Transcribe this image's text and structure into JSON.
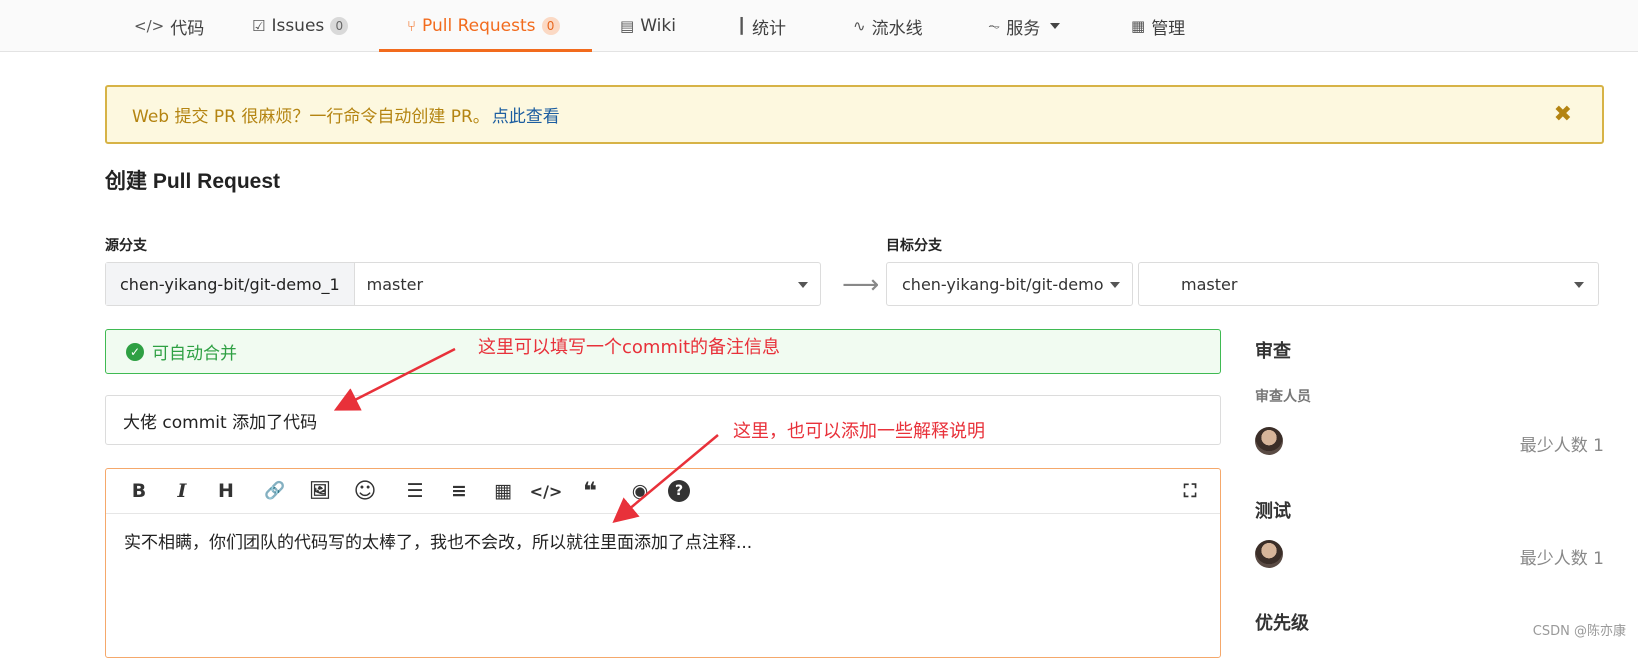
{
  "nav": {
    "tabs": [
      {
        "label": "代码",
        "icon": "code-icon",
        "glyph": "</>"
      },
      {
        "label": "Issues",
        "icon": "issues-icon",
        "glyph": "☑",
        "count": "0"
      },
      {
        "label": "Pull Requests",
        "icon": "pull-request-icon",
        "glyph": "⑂",
        "count": "0",
        "active": true
      },
      {
        "label": "Wiki",
        "icon": "book-icon",
        "glyph": "▤"
      },
      {
        "label": "统计",
        "icon": "bar-chart-icon",
        "glyph": "┃"
      },
      {
        "label": "流水线",
        "icon": "pipeline-icon",
        "glyph": "∿"
      },
      {
        "label": "服务",
        "icon": "pulse-icon",
        "glyph": "⏦"
      },
      {
        "label": "管理",
        "icon": "admin-icon",
        "glyph": "▦"
      }
    ]
  },
  "notice": {
    "text": "Web 提交 PR 很麻烦？一行命令自动创建 PR。",
    "link": "点此查看",
    "close": "✖"
  },
  "page_title": "创建 Pull Request",
  "source": {
    "label": "源分支",
    "repo": "chen-yikang-bit/git-demo_1",
    "branch": "master"
  },
  "arrow": "⟶",
  "target": {
    "label": "目标分支",
    "repo": "chen-yikang-bit/git-demo",
    "branch": "master"
  },
  "merge_status": "可自动合并",
  "pr_title_value": "大佬 commit 添加了代码",
  "editor": {
    "toolbar": [
      {
        "icon": "bold-icon",
        "glyph": "B"
      },
      {
        "icon": "italic-icon",
        "glyph": "I"
      },
      {
        "icon": "heading-icon",
        "glyph": "H"
      },
      {
        "icon": "link-icon",
        "glyph": "🔗"
      },
      {
        "icon": "image-icon",
        "glyph": "🖼"
      },
      {
        "icon": "emoji-icon",
        "glyph": "☺"
      },
      {
        "icon": "bullet-list-icon",
        "glyph": "☰"
      },
      {
        "icon": "numbered-list-icon",
        "glyph": "≡"
      },
      {
        "icon": "table-icon",
        "glyph": "▦"
      },
      {
        "icon": "code-icon",
        "glyph": "</>"
      },
      {
        "icon": "quote-icon",
        "glyph": "❝"
      },
      {
        "icon": "preview-eye-icon",
        "glyph": "◉"
      },
      {
        "icon": "help-icon",
        "glyph": "?"
      },
      {
        "icon": "fullscreen-icon",
        "glyph": "⛶"
      }
    ],
    "body": "实不相瞒，你们团队的代码写的太棒了，我也不会改，所以就往里面添加了点注释..."
  },
  "annotations": {
    "one": "这里可以填写一个commit的备注信息",
    "two": "这里，也可以添加一些解释说明"
  },
  "sidebar": {
    "review_heading": "审查",
    "reviewers_label": "审查人员",
    "reviewers_min": "最少人数 1",
    "test_heading": "测试",
    "testers_min": "最少人数 1",
    "priority_heading": "优先级"
  },
  "watermark": "CSDN @陈亦康",
  "colors": {
    "accent": "#f26b1d",
    "success": "#2ea043",
    "warning_bg": "#fdf8df",
    "annotation": "#e8313a"
  }
}
